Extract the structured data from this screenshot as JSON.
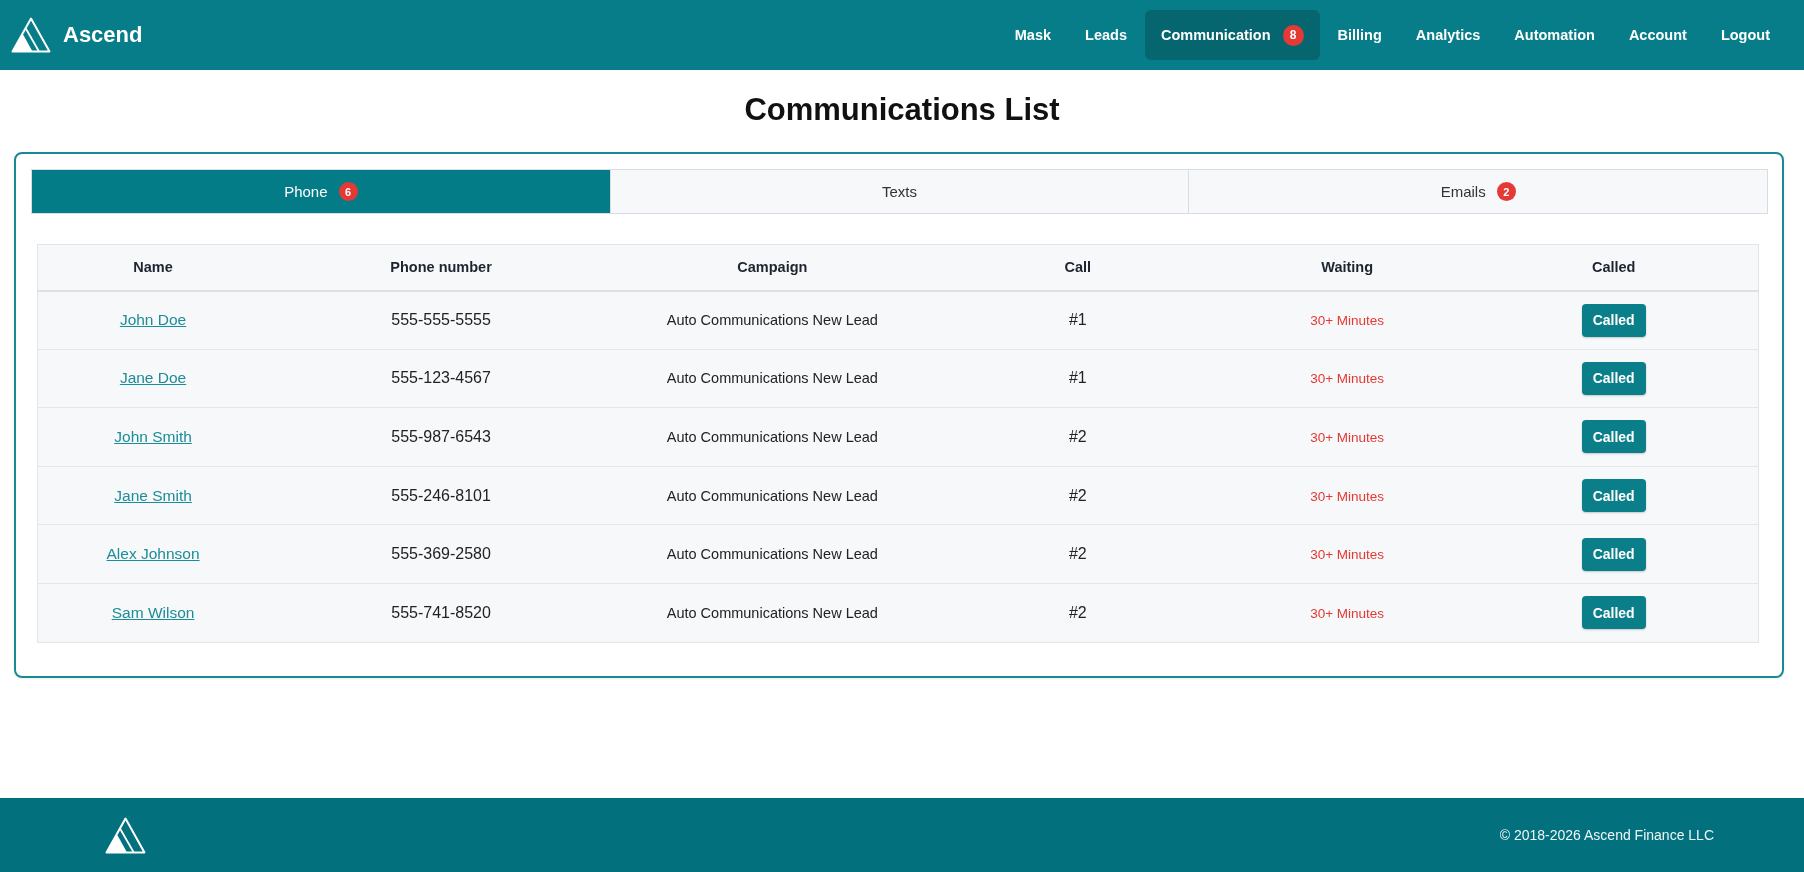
{
  "header": {
    "brand": "Ascend",
    "nav": [
      {
        "label": "Mask",
        "selected": false
      },
      {
        "label": "Leads",
        "selected": false
      },
      {
        "label": "Communication",
        "selected": true,
        "badge": "8"
      },
      {
        "label": "Billing",
        "selected": false
      },
      {
        "label": "Analytics",
        "selected": false
      },
      {
        "label": "Automation",
        "selected": false
      },
      {
        "label": "Account",
        "selected": false
      },
      {
        "label": "Logout",
        "selected": false
      }
    ]
  },
  "page": {
    "title": "Communications List"
  },
  "tabs": [
    {
      "label": "Phone",
      "selected": true,
      "badge": "6"
    },
    {
      "label": "Texts",
      "selected": false
    },
    {
      "label": "Emails",
      "selected": false,
      "badge": "2"
    }
  ],
  "table": {
    "columns": [
      "Name",
      "Phone number",
      "Campaign",
      "Call",
      "Waiting",
      "Called"
    ],
    "rows": [
      {
        "name": "John Doe",
        "phone": "555-555-5555",
        "campaign": "Auto Communications New Lead",
        "call": "#1",
        "waiting": "30+ Minutes",
        "action": "Called"
      },
      {
        "name": "Jane Doe",
        "phone": "555-123-4567",
        "campaign": "Auto Communications New Lead",
        "call": "#1",
        "waiting": "30+ Minutes",
        "action": "Called"
      },
      {
        "name": "John Smith",
        "phone": "555-987-6543",
        "campaign": "Auto Communications New Lead",
        "call": "#2",
        "waiting": "30+ Minutes",
        "action": "Called"
      },
      {
        "name": "Jane Smith",
        "phone": "555-246-8101",
        "campaign": "Auto Communications New Lead",
        "call": "#2",
        "waiting": "30+ Minutes",
        "action": "Called"
      },
      {
        "name": "Alex Johnson",
        "phone": "555-369-2580",
        "campaign": "Auto Communications New Lead",
        "call": "#2",
        "waiting": "30+ Minutes",
        "action": "Called"
      },
      {
        "name": "Sam Wilson",
        "phone": "555-741-8520",
        "campaign": "Auto Communications New Lead",
        "call": "#2",
        "waiting": "30+ Minutes",
        "action": "Called"
      }
    ]
  },
  "footer": {
    "copyright": "© 2018-2026 Ascend Finance LLC"
  }
}
